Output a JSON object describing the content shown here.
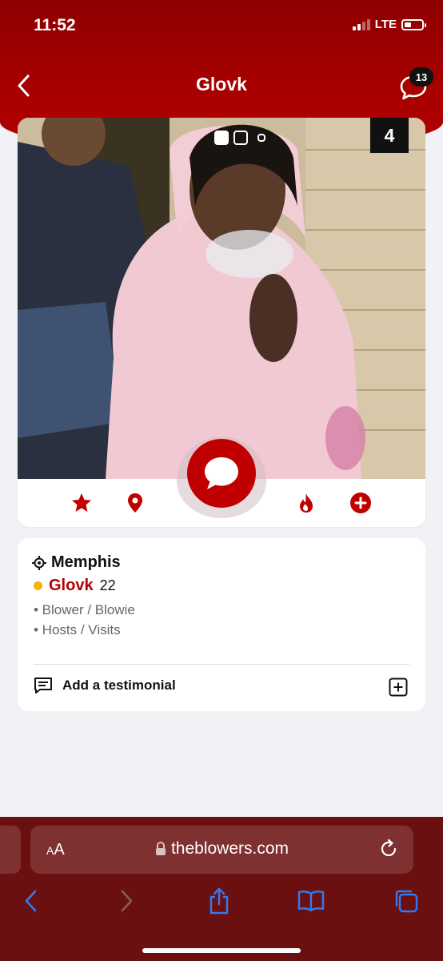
{
  "status": {
    "time": "11:52",
    "network": "LTE"
  },
  "header": {
    "title": "Glovk",
    "chat_badge": "13"
  },
  "photo": {
    "page_number": "4"
  },
  "profile": {
    "location": "Memphis",
    "name": "Glovk",
    "age": "22",
    "tags": [
      "• Blower / Blowie",
      "• Hosts / Visits"
    ],
    "testimonial_label": "Add a testimonial"
  },
  "browser": {
    "text_size_label": "AA",
    "url": "theblowers.com"
  },
  "colors": {
    "brand_red": "#b30000",
    "safari_bar": "#6a1010"
  }
}
